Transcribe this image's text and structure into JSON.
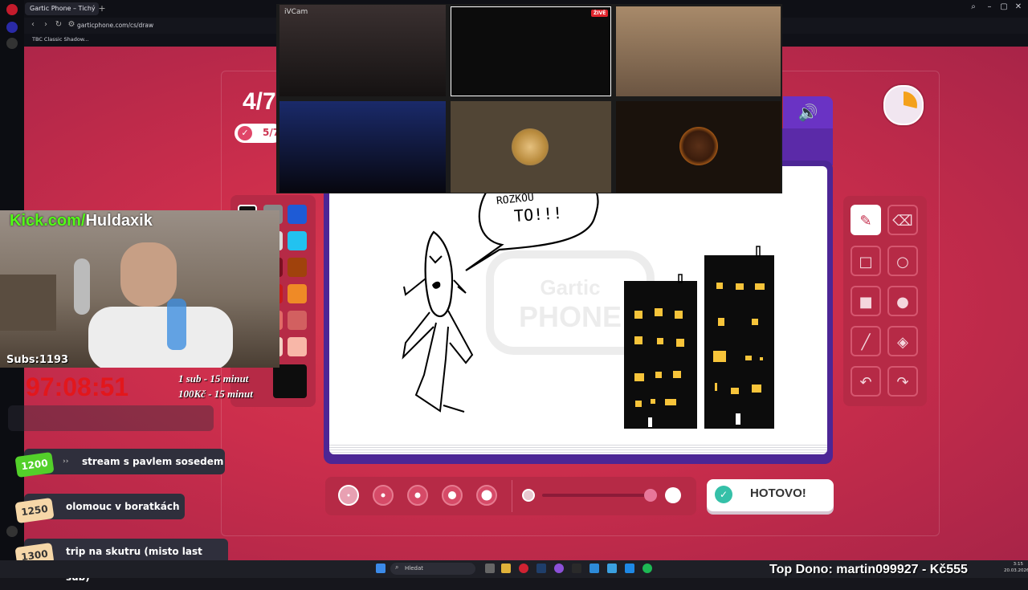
{
  "browser": {
    "tab_title": "Gartic Phone – Tichý",
    "url": "garticphone.com/cs/draw",
    "bookmark": "TBC Classic Shadow..."
  },
  "game": {
    "round": "4/7",
    "progress": "5/7",
    "done_button": "HOTOVO!",
    "brand_watermark": "Gartic PHONE",
    "speech_text_line1": "ROZKOU",
    "speech_text_line2": "TO!!!"
  },
  "palette": {
    "colors": [
      "#111111",
      "#888888",
      "#1e5bd6",
      "#ffffff",
      "#d9d9d9",
      "#22c2f0",
      "#7a1020",
      "#c24d3a",
      "#a0420c",
      "#c71c1c",
      "#ef8a26",
      "#f8a5a5",
      "#f2d0c4",
      "#e06a66",
      "#f8b7a8"
    ]
  },
  "webcams": {
    "tile1_label": "iVCam",
    "live_badge": "ŽIVĚ"
  },
  "stream": {
    "kick_prefix": "Kick.com/",
    "kick_user": "Huldaxik",
    "subs": "Subs:1193",
    "countdown": "97:08:51",
    "sub_rule": "1 sub - 15 minut",
    "donation_rule": "100Kč - 15 minut",
    "goals": [
      {
        "amount": "1200",
        "label": "stream s pavlem sosedem"
      },
      {
        "amount": "1250",
        "label": "olomouc v boratkách"
      },
      {
        "amount": "1300",
        "label": "trip na skutru (misto last sub)"
      }
    ],
    "top_dono": "Top Dono: martin099927 - Kč555"
  },
  "taskbar": {
    "search_placeholder": "Hledat",
    "time": "3:15",
    "date": "20.03.2026"
  },
  "accent_colors": {
    "page_red": "#cc2e4c",
    "canvas_purple": "#4c2695",
    "done_green": "#35c0a8",
    "kick_green": "#53fc18",
    "countdown_red": "#e2171c"
  }
}
